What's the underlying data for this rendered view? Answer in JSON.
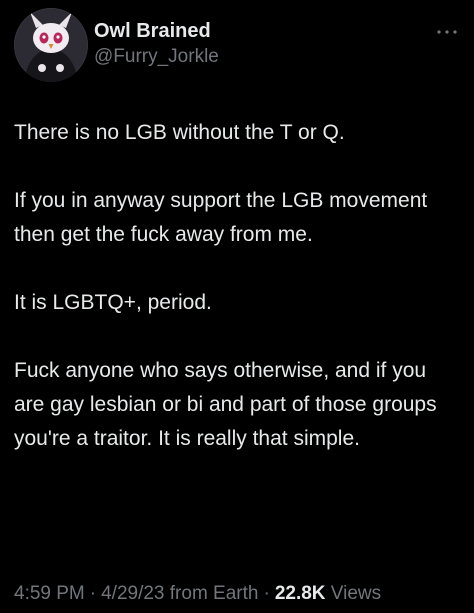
{
  "author": {
    "display_name": "Owl Brained",
    "handle": "@Furry_Jorkle",
    "avatar_icon": "cartoon-character-avatar"
  },
  "more_icon": "more-dots-icon",
  "tweet": {
    "paragraphs": [
      "There is no LGB without the T or Q.",
      "If you in anyway support the LGB movement then get the fuck away from me.",
      "It is LGBTQ+, period.",
      "Fuck anyone who says otherwise, and if you are gay lesbian or bi and part of those groups you're a traitor. It is really that simple."
    ]
  },
  "meta": {
    "time": "4:59 PM",
    "separator": "·",
    "date": "4/29/23",
    "source": "from Earth",
    "views_count": "22.8K",
    "views_label": "Views"
  },
  "colors": {
    "background": "#000000",
    "text": "#e7e9ea",
    "secondary": "#71767b"
  }
}
